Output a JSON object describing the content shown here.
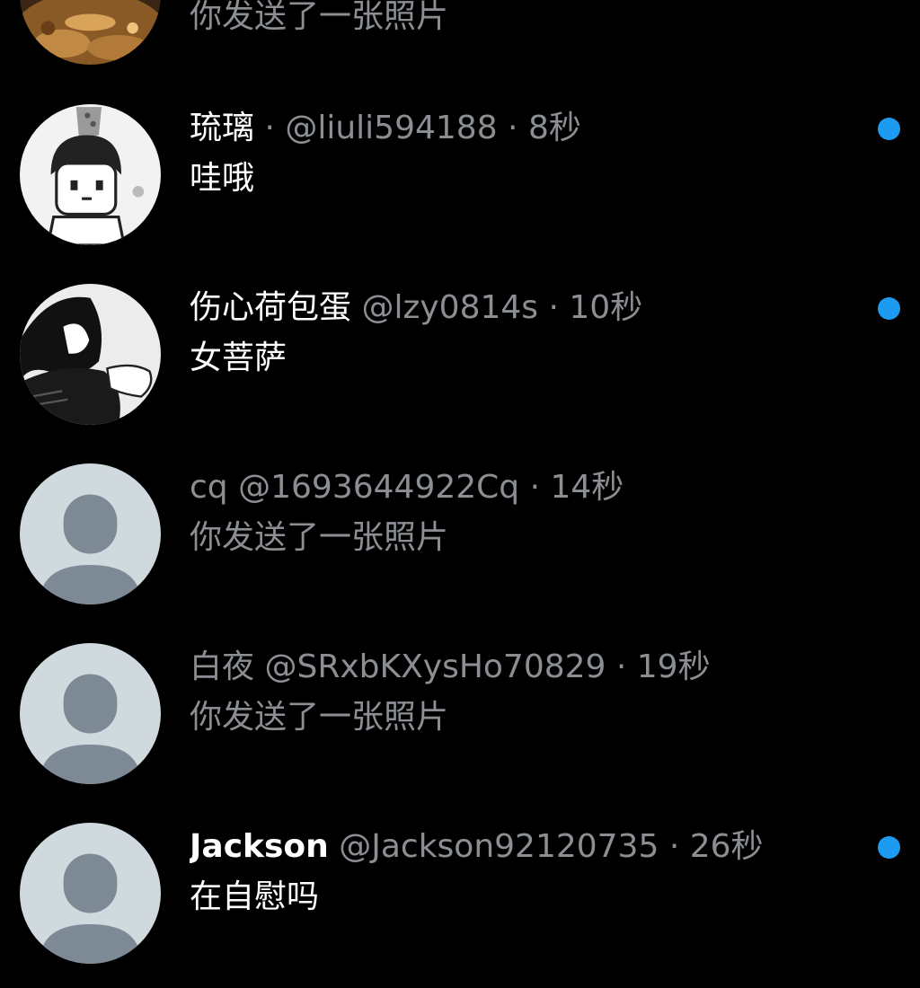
{
  "colors": {
    "background": "#000000",
    "unread_dot": "#1d9bf0",
    "secondary_text": "#8b8f94",
    "default_avatar_bg": "#cfd9de",
    "default_avatar_fg": "#7d8a95"
  },
  "conversations": [
    {
      "display_name": "",
      "handle": "",
      "separator": "",
      "time": "",
      "preview": "你发送了一张照片",
      "unread": false,
      "avatar": "food-photo"
    },
    {
      "display_name": "琉璃",
      "handle": "@liuli594188",
      "separator": " · ",
      "time": "8秒",
      "preview": "哇哦",
      "unread": true,
      "avatar": "cartoon-boy"
    },
    {
      "display_name": "伤心荷包蛋",
      "handle": "@lzy0814s",
      "separator": " · ",
      "time": "10秒",
      "preview": "女菩萨",
      "unread": true,
      "avatar": "manga-character"
    },
    {
      "display_name": "cq",
      "handle": "@1693644922Cq",
      "separator": " · ",
      "time": "14秒",
      "preview": "你发送了一张照片",
      "unread": false,
      "avatar": "default-profile"
    },
    {
      "display_name": "白夜",
      "handle": "@SRxbKXysHo70829",
      "separator": " · ",
      "time": "19秒",
      "preview": "你发送了一张照片",
      "unread": false,
      "avatar": "default-profile"
    },
    {
      "display_name": "Jackson",
      "handle": "@Jackson92120735",
      "separator": " · ",
      "time": "26秒",
      "preview": "在自慰吗",
      "unread": true,
      "avatar": "default-profile"
    }
  ]
}
